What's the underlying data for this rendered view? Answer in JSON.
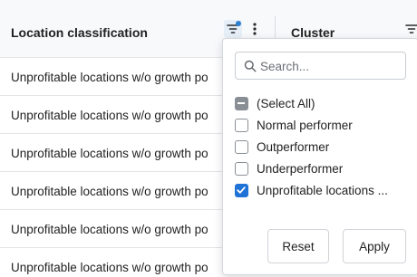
{
  "header": {
    "location_title": "Location classification",
    "cluster_title": "Cluster"
  },
  "rows": [
    "Unprofitable locations w/o growth po",
    "Unprofitable locations w/o growth po",
    "Unprofitable locations w/o growth po",
    "Unprofitable locations w/o growth po",
    "Unprofitable locations w/o growth po",
    "Unprofitable locations w/o growth po"
  ],
  "filter_popup": {
    "search_placeholder": "Search...",
    "options": [
      {
        "label": "(Select All)",
        "state": "indeterminate"
      },
      {
        "label": "Normal performer",
        "state": "unchecked"
      },
      {
        "label": "Outperformer",
        "state": "unchecked"
      },
      {
        "label": "Underperformer",
        "state": "unchecked"
      },
      {
        "label": "Unprofitable locations ...",
        "state": "checked"
      }
    ],
    "reset_label": "Reset",
    "apply_label": "Apply"
  },
  "colors": {
    "accent": "#1f72d6",
    "filter_active_dot": "#2f7fd0",
    "header_bg": "#f8f9fb"
  },
  "icons": {
    "filter": "filter-icon",
    "menu": "more-vertical-icon",
    "search": "search-icon",
    "check": "check-icon"
  }
}
